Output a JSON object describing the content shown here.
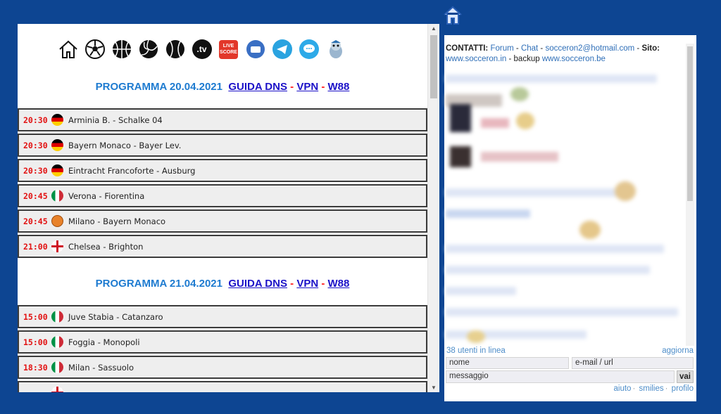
{
  "icons": [
    "home-icon",
    "soccer-ball-icon",
    "basketball-icon",
    "volleyball-icon",
    "baseball-icon",
    "tv-icon",
    "live-score-icon",
    "forum-icon",
    "telegram-icon",
    "chat-bubble-icon",
    "mascot-icon"
  ],
  "icon_labels": {
    "tv": ".tv",
    "live": "LIVE SCORE"
  },
  "schedules": [
    {
      "program": "PROGRAMMA 20.04.2021",
      "links": [
        "GUIDA DNS",
        "VPN",
        "W88"
      ],
      "matches": [
        {
          "time": "20:30",
          "flag": "germany",
          "name": "Arminia B. - Schalke 04"
        },
        {
          "time": "20:30",
          "flag": "germany",
          "name": "Bayern Monaco - Bayer Lev."
        },
        {
          "time": "20:30",
          "flag": "germany",
          "name": "Eintracht Francoforte - Ausburg"
        },
        {
          "time": "20:45",
          "flag": "italy",
          "name": "Verona - Fiorentina"
        },
        {
          "time": "20:45",
          "flag": "basketball",
          "name": "Milano - Bayern Monaco"
        },
        {
          "time": "21:00",
          "flag": "england",
          "name": "Chelsea - Brighton"
        }
      ]
    },
    {
      "program": "PROGRAMMA 21.04.2021",
      "links": [
        "GUIDA DNS",
        "VPN",
        "W88"
      ],
      "matches": [
        {
          "time": "15:00",
          "flag": "italy",
          "name": "Juve Stabia - Catanzaro"
        },
        {
          "time": "15:00",
          "flag": "italy",
          "name": "Foggia - Monopoli"
        },
        {
          "time": "18:30",
          "flag": "italy",
          "name": "Milan - Sassuolo"
        }
      ]
    }
  ],
  "chat": {
    "contacts_label": "CONTATTI:",
    "forum": "Forum",
    "chat": "Chat",
    "email": "socceron2@hotmail.com",
    "site_label": "Sito:",
    "site1": "www.socceron.in",
    "backup_label": "backup",
    "site2": "www.socceron.be",
    "users_online": "38 utenti in linea",
    "refresh": "aggiorna",
    "name_placeholder": "nome",
    "email_placeholder": "e-mail / url",
    "message_placeholder": "messaggio",
    "send": "vai",
    "footer": [
      "aiuto",
      "smilies",
      "profilo"
    ]
  },
  "colors": {
    "background": "#0d4592",
    "program": "#1e7bd0",
    "link": "#1c12c8",
    "time": "#e21212"
  }
}
